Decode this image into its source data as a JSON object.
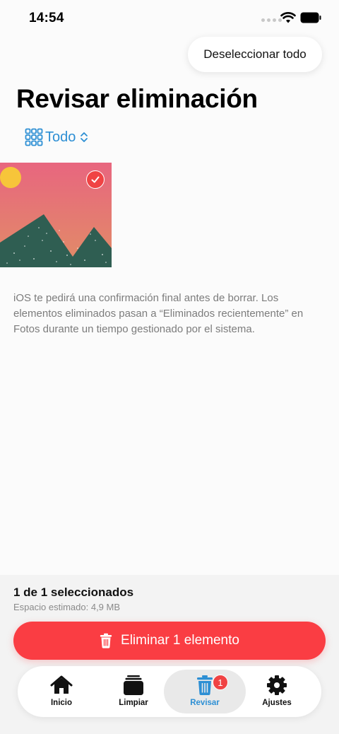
{
  "status_bar": {
    "time": "14:54"
  },
  "header": {
    "deselect_label": "Deseleccionar todo",
    "title": "Revisar eliminación"
  },
  "filter": {
    "label": "Todo"
  },
  "info_text": "iOS te pedirá una confirmación final antes de borrar. Los elementos eliminados pasan a “Eliminados recientemente” en Fotos durante un tiempo gestionado por el sistema.",
  "footer": {
    "selected_count": "1 de 1 seleccionados",
    "estimated_space": "Espacio estimado: 4,9 MB",
    "delete_label": "Eliminar 1 elemento"
  },
  "tabs": [
    {
      "label": "Inicio",
      "icon": "home-icon"
    },
    {
      "label": "Limpiar",
      "icon": "stack-icon"
    },
    {
      "label": "Revisar",
      "icon": "trash-icon",
      "badge": "1",
      "active": true
    },
    {
      "label": "Ajustes",
      "icon": "gear-icon"
    }
  ],
  "colors": {
    "accent": "#2d8fd4",
    "danger": "#fa3d43",
    "photo_top": "#e8667f",
    "photo_mountain": "#2f5e52",
    "photo_sun": "#f7c53a"
  }
}
